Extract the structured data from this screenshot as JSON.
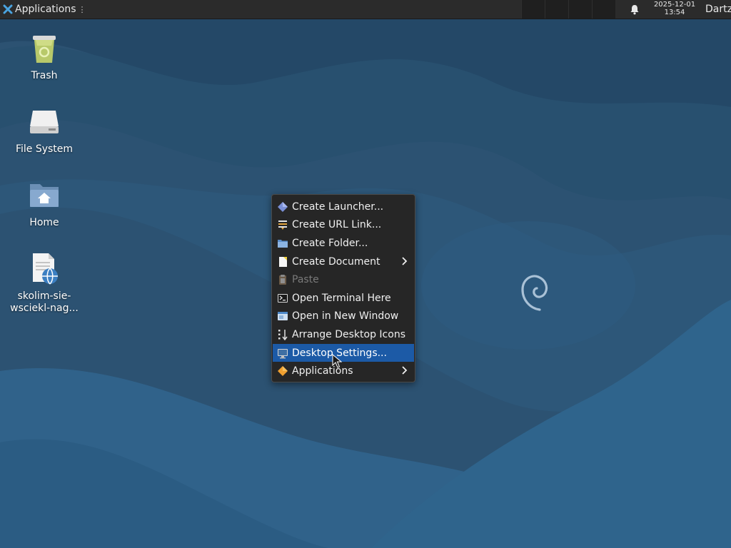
{
  "panel": {
    "applications_label": "Applications",
    "applications_dots": "⋮",
    "clock_date": "2025-12-01",
    "clock_time": "13:54",
    "user": "Dartz"
  },
  "desktop_icons": [
    {
      "label": "Trash",
      "icon": "trash-icon"
    },
    {
      "label": "File System",
      "icon": "drive-icon"
    },
    {
      "label": "Home",
      "icon": "home-folder-icon"
    },
    {
      "label": "skolim-sie-wsciekl-nag...",
      "icon": "document-web-icon"
    }
  ],
  "context_menu": {
    "items": [
      {
        "label": "Create Launcher...",
        "icon": "launcher-icon"
      },
      {
        "label": "Create URL Link...",
        "icon": "url-link-icon"
      },
      {
        "label": "Create Folder...",
        "icon": "folder-icon"
      },
      {
        "label": "Create Document",
        "icon": "document-icon",
        "submenu": true
      },
      {
        "label": "Paste",
        "icon": "clipboard-icon",
        "disabled": true
      },
      {
        "label": "Open Terminal Here",
        "icon": "terminal-icon"
      },
      {
        "label": "Open in New Window",
        "icon": "window-icon"
      },
      {
        "label": "Arrange Desktop Icons",
        "icon": "arrange-icon"
      },
      {
        "label": "Desktop Settings...",
        "icon": "desktop-settings-icon",
        "selected": true
      },
      {
        "label": "Applications",
        "icon": "applications-icon",
        "submenu": true
      }
    ]
  },
  "colors": {
    "wallpaper_base": "#2c5272",
    "panel_bg": "#2b2b2b",
    "menu_bg": "#262626",
    "menu_highlight": "#1c5aa6"
  }
}
